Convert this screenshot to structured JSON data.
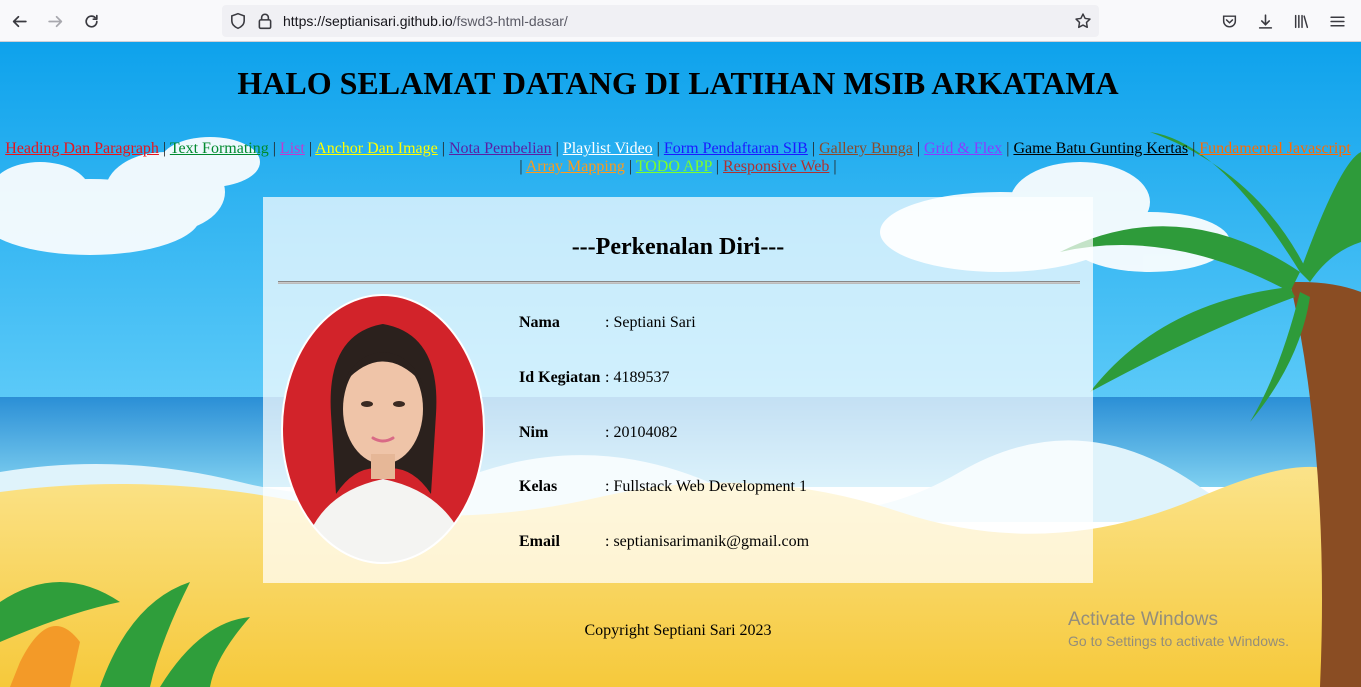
{
  "browser": {
    "url_host": "https://septianisari.github.io",
    "url_path": "/fswd3-html-dasar/"
  },
  "page": {
    "title": "HALO SELAMAT DATANG DI LATIHAN MSIB ARKATAMA",
    "nav": [
      {
        "label": "Heading Dan Paragraph",
        "color": "#e8141b"
      },
      {
        "label": "Text Formating",
        "color": "#008a2e"
      },
      {
        "label": "List",
        "color": "#c13bd0"
      },
      {
        "label": "Anchor Dan Image",
        "color": "#ffff00"
      },
      {
        "label": "Nota Pembelian",
        "color": "#5a1fa3"
      },
      {
        "label": "Playlist Video",
        "color": "#ffffff"
      },
      {
        "label": "Form Pendaftaran SIB",
        "color": "#1a1aff"
      },
      {
        "label": "Gallery Bunga",
        "color": "#8b4a2b"
      },
      {
        "label": "Grid & Flex",
        "color": "#8a3cff"
      },
      {
        "label": "Game Batu Gunting Kertas",
        "color": "#000000"
      },
      {
        "label": "Fundamental Javascript",
        "color": "#ff6a00"
      },
      {
        "label": "Array Mapping",
        "color": "#ff9a1a"
      },
      {
        "label": "TODO APP",
        "color": "#7cff2a"
      },
      {
        "label": "Responsive Web",
        "color": "#b03030"
      }
    ],
    "card": {
      "title": "---Perkenalan Diri---",
      "rows": [
        {
          "label": "Nama",
          "value": ": Septiani Sari"
        },
        {
          "label": "Id Kegiatan",
          "value": ": 4189537"
        },
        {
          "label": "Nim",
          "value": ": 20104082"
        },
        {
          "label": "Kelas",
          "value": ": Fullstack Web Development 1"
        },
        {
          "label": "Email",
          "value": ": septianisarimanik@gmail.com"
        }
      ]
    },
    "footer": "Copyright Septiani Sari 2023"
  },
  "watermark": {
    "line1": "Activate Windows",
    "line2": "Go to Settings to activate Windows."
  }
}
